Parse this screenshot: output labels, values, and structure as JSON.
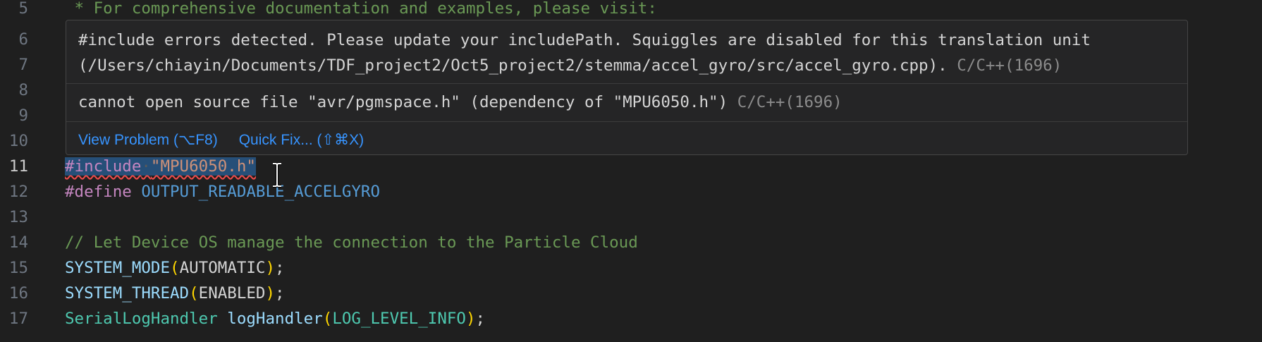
{
  "editor": {
    "lines": [
      {
        "num": "5",
        "tokens": [
          {
            "t": " * For comprehensive documentation and examples, please visit:",
            "c": "comment"
          }
        ]
      },
      {
        "num": "6",
        "tokens": []
      },
      {
        "num": "7",
        "tokens": []
      },
      {
        "num": "8",
        "tokens": []
      },
      {
        "num": "9",
        "tokens": []
      },
      {
        "num": "10",
        "tokens": []
      },
      {
        "num": "11",
        "active": true,
        "tokens": [
          {
            "t": "#include",
            "c": "pre",
            "sel": true
          },
          {
            "t": "·",
            "c": "ws",
            "sel": true
          },
          {
            "t": "\"MPU6050.h\"",
            "c": "str",
            "sel": true
          }
        ]
      },
      {
        "num": "12",
        "tokens": [
          {
            "t": "#define ",
            "c": "pre"
          },
          {
            "t": "OUTPUT_READABLE_ACCELGYRO",
            "c": "macro"
          }
        ]
      },
      {
        "num": "13",
        "tokens": []
      },
      {
        "num": "14",
        "tokens": [
          {
            "t": "// Let Device OS manage the connection to the Particle Cloud",
            "c": "comment"
          }
        ]
      },
      {
        "num": "15",
        "tokens": [
          {
            "t": "SYSTEM_MODE",
            "c": "var"
          },
          {
            "t": "(",
            "c": "paren"
          },
          {
            "t": "AUTOMATIC",
            "c": "ident"
          },
          {
            "t": ")",
            "c": "paren"
          },
          {
            "t": ";",
            "c": "punc"
          }
        ]
      },
      {
        "num": "16",
        "tokens": [
          {
            "t": "SYSTEM_THREAD",
            "c": "var"
          },
          {
            "t": "(",
            "c": "paren"
          },
          {
            "t": "ENABLED",
            "c": "ident"
          },
          {
            "t": ")",
            "c": "paren"
          },
          {
            "t": ";",
            "c": "punc"
          }
        ]
      },
      {
        "num": "17",
        "tokens": [
          {
            "t": "SerialLogHandler",
            "c": "type"
          },
          {
            "t": " ",
            "c": "punc"
          },
          {
            "t": "logHandler",
            "c": "var"
          },
          {
            "t": "(",
            "c": "paren"
          },
          {
            "t": "LOG_LEVEL_INFO",
            "c": "type"
          },
          {
            "t": ")",
            "c": "paren"
          },
          {
            "t": ";",
            "c": "punc"
          }
        ]
      }
    ]
  },
  "hover": {
    "msg1_line1": "#include errors detected. Please update your includePath. Squiggles are disabled for this translation unit",
    "msg1_line2": "(/Users/chiayin/Documents/TDF_project2/Oct5_project2/stemma/accel_gyro/src/accel_gyro.cpp).",
    "msg1_code": "C/C++(1696)",
    "msg2": "cannot open source file \"avr/pgmspace.h\" (dependency of \"MPU6050.h\")",
    "msg2_code": "C/C++(1696)",
    "view_problem": "View Problem (⌥F8)",
    "quick_fix": "Quick Fix... (⇧⌘X)"
  },
  "colors": {
    "background": "#1f1f1f",
    "link": "#3794ff",
    "error_squiggle": "#f14c4c",
    "selection": "#264f78"
  },
  "icons": {
    "cursor": "i-beam-cursor-icon"
  }
}
